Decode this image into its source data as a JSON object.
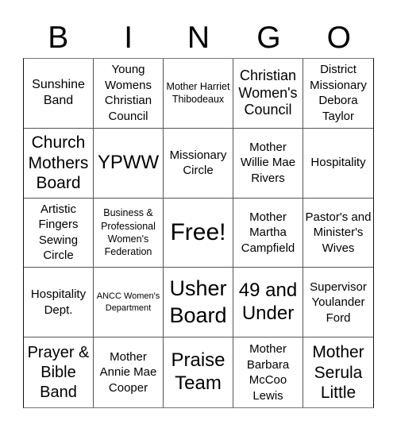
{
  "header": {
    "letters": [
      "B",
      "I",
      "N",
      "G",
      "O"
    ]
  },
  "cells": [
    "Sunshine Band",
    "Young Womens Christian Council",
    "Mother Harriet Thibodeaux",
    "Christian Women's Council",
    "District Missionary Debora Taylor",
    "Church Mothers Board",
    "YPWW",
    "Missionary Circle",
    "Mother Willie Mae Rivers",
    "Hospitality",
    "Artistic Fingers Sewing Circle",
    "Business & Professional Women's Federation",
    "Free!",
    "Mother Martha Campfield",
    "Pastor's and Minister's Wives",
    "Hospitality Dept.",
    "ANCC Women's Department",
    "Usher Board",
    "49 and Under",
    "Supervisor Youlander Ford",
    "Prayer & Bible Band",
    "Mother Annie Mae Cooper",
    "Praise Team",
    "Mother Barbara McCoo Lewis",
    "Mother Serula Little"
  ]
}
